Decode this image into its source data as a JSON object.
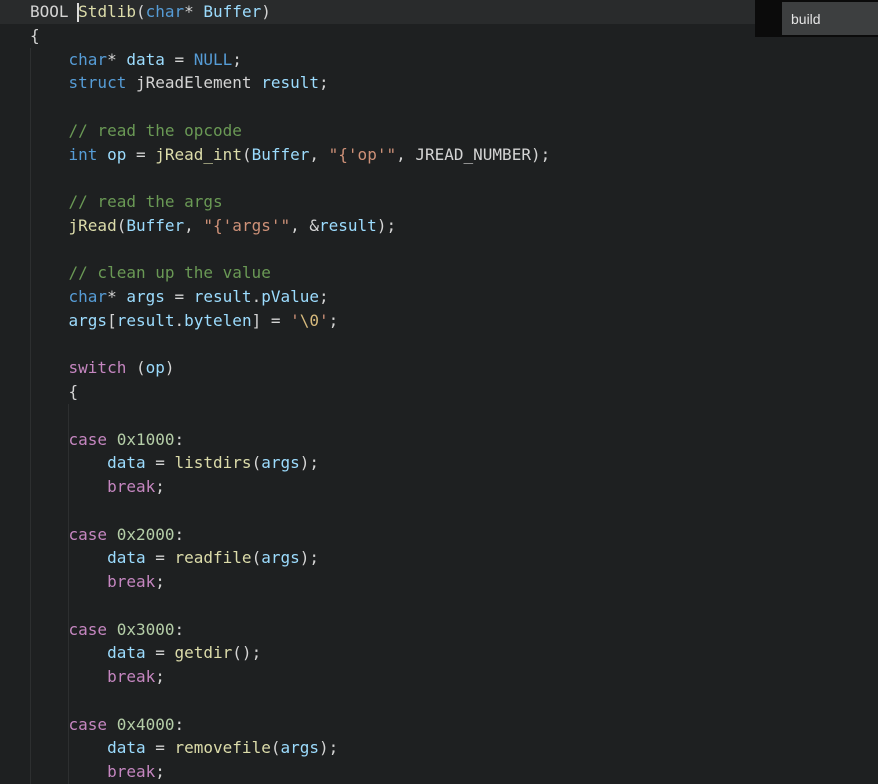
{
  "overlay": {
    "build_label": "build"
  },
  "colors": {
    "background": "#1e2021",
    "current_line": "rgba(255,255,255,0.05)",
    "default": "#d4d4d4",
    "keyword": "#569cd6",
    "control": "#c586c0",
    "function": "#dcdcaa",
    "variable": "#9cdcfe",
    "comment": "#6a9955",
    "string": "#ce9178",
    "number": "#b5cea8",
    "escape": "#d7ba7d"
  },
  "code": {
    "language": "c",
    "current_line": 0,
    "lines": [
      {
        "tokens": [
          {
            "t": "BOOL ",
            "c": "default"
          },
          {
            "t": "Stdlib",
            "c": "function"
          },
          {
            "t": "(",
            "c": "default"
          },
          {
            "t": "char",
            "c": "keyword"
          },
          {
            "t": "* ",
            "c": "default"
          },
          {
            "t": "Buffer",
            "c": "variable"
          },
          {
            "t": ")",
            "c": "default"
          }
        ]
      },
      {
        "tokens": [
          {
            "t": "{",
            "c": "default"
          }
        ]
      },
      {
        "tokens": [
          {
            "t": "    ",
            "c": "default"
          },
          {
            "t": "char",
            "c": "keyword"
          },
          {
            "t": "* ",
            "c": "default"
          },
          {
            "t": "data",
            "c": "variable"
          },
          {
            "t": " = ",
            "c": "default"
          },
          {
            "t": "NULL",
            "c": "keyword"
          },
          {
            "t": ";",
            "c": "default"
          }
        ]
      },
      {
        "tokens": [
          {
            "t": "    ",
            "c": "default"
          },
          {
            "t": "struct",
            "c": "keyword"
          },
          {
            "t": " jReadElement ",
            "c": "default"
          },
          {
            "t": "result",
            "c": "variable"
          },
          {
            "t": ";",
            "c": "default"
          }
        ]
      },
      {
        "tokens": []
      },
      {
        "tokens": [
          {
            "t": "    ",
            "c": "default"
          },
          {
            "t": "// read the opcode",
            "c": "comment"
          }
        ]
      },
      {
        "tokens": [
          {
            "t": "    ",
            "c": "default"
          },
          {
            "t": "int",
            "c": "keyword"
          },
          {
            "t": " ",
            "c": "default"
          },
          {
            "t": "op",
            "c": "variable"
          },
          {
            "t": " = ",
            "c": "default"
          },
          {
            "t": "jRead_int",
            "c": "function"
          },
          {
            "t": "(",
            "c": "default"
          },
          {
            "t": "Buffer",
            "c": "variable"
          },
          {
            "t": ", ",
            "c": "default"
          },
          {
            "t": "\"{'op'\"",
            "c": "string"
          },
          {
            "t": ", ",
            "c": "default"
          },
          {
            "t": "JREAD_NUMBER",
            "c": "default"
          },
          {
            "t": ");",
            "c": "default"
          }
        ]
      },
      {
        "tokens": []
      },
      {
        "tokens": [
          {
            "t": "    ",
            "c": "default"
          },
          {
            "t": "// read the args",
            "c": "comment"
          }
        ]
      },
      {
        "tokens": [
          {
            "t": "    ",
            "c": "default"
          },
          {
            "t": "jRead",
            "c": "function"
          },
          {
            "t": "(",
            "c": "default"
          },
          {
            "t": "Buffer",
            "c": "variable"
          },
          {
            "t": ", ",
            "c": "default"
          },
          {
            "t": "\"{'args'\"",
            "c": "string"
          },
          {
            "t": ", &",
            "c": "default"
          },
          {
            "t": "result",
            "c": "variable"
          },
          {
            "t": ");",
            "c": "default"
          }
        ]
      },
      {
        "tokens": []
      },
      {
        "tokens": [
          {
            "t": "    ",
            "c": "default"
          },
          {
            "t": "// clean up the value",
            "c": "comment"
          }
        ]
      },
      {
        "tokens": [
          {
            "t": "    ",
            "c": "default"
          },
          {
            "t": "char",
            "c": "keyword"
          },
          {
            "t": "* ",
            "c": "default"
          },
          {
            "t": "args",
            "c": "variable"
          },
          {
            "t": " = ",
            "c": "default"
          },
          {
            "t": "result",
            "c": "variable"
          },
          {
            "t": ".",
            "c": "default"
          },
          {
            "t": "pValue",
            "c": "variable"
          },
          {
            "t": ";",
            "c": "default"
          }
        ]
      },
      {
        "tokens": [
          {
            "t": "    ",
            "c": "default"
          },
          {
            "t": "args",
            "c": "variable"
          },
          {
            "t": "[",
            "c": "default"
          },
          {
            "t": "result",
            "c": "variable"
          },
          {
            "t": ".",
            "c": "default"
          },
          {
            "t": "bytelen",
            "c": "variable"
          },
          {
            "t": "] = ",
            "c": "default"
          },
          {
            "t": "'",
            "c": "string"
          },
          {
            "t": "\\0",
            "c": "escape"
          },
          {
            "t": "'",
            "c": "string"
          },
          {
            "t": ";",
            "c": "default"
          }
        ]
      },
      {
        "tokens": []
      },
      {
        "tokens": [
          {
            "t": "    ",
            "c": "default"
          },
          {
            "t": "switch",
            "c": "control"
          },
          {
            "t": " (",
            "c": "default"
          },
          {
            "t": "op",
            "c": "variable"
          },
          {
            "t": ")",
            "c": "default"
          }
        ]
      },
      {
        "tokens": [
          {
            "t": "    {",
            "c": "default"
          }
        ]
      },
      {
        "tokens": []
      },
      {
        "tokens": [
          {
            "t": "    ",
            "c": "default"
          },
          {
            "t": "case",
            "c": "control"
          },
          {
            "t": " ",
            "c": "default"
          },
          {
            "t": "0x1000",
            "c": "number"
          },
          {
            "t": ":",
            "c": "default"
          }
        ]
      },
      {
        "tokens": [
          {
            "t": "        ",
            "c": "default"
          },
          {
            "t": "data",
            "c": "variable"
          },
          {
            "t": " = ",
            "c": "default"
          },
          {
            "t": "listdirs",
            "c": "function"
          },
          {
            "t": "(",
            "c": "default"
          },
          {
            "t": "args",
            "c": "variable"
          },
          {
            "t": ");",
            "c": "default"
          }
        ]
      },
      {
        "tokens": [
          {
            "t": "        ",
            "c": "default"
          },
          {
            "t": "break",
            "c": "control"
          },
          {
            "t": ";",
            "c": "default"
          }
        ]
      },
      {
        "tokens": []
      },
      {
        "tokens": [
          {
            "t": "    ",
            "c": "default"
          },
          {
            "t": "case",
            "c": "control"
          },
          {
            "t": " ",
            "c": "default"
          },
          {
            "t": "0x2000",
            "c": "number"
          },
          {
            "t": ":",
            "c": "default"
          }
        ]
      },
      {
        "tokens": [
          {
            "t": "        ",
            "c": "default"
          },
          {
            "t": "data",
            "c": "variable"
          },
          {
            "t": " = ",
            "c": "default"
          },
          {
            "t": "readfile",
            "c": "function"
          },
          {
            "t": "(",
            "c": "default"
          },
          {
            "t": "args",
            "c": "variable"
          },
          {
            "t": ");",
            "c": "default"
          }
        ]
      },
      {
        "tokens": [
          {
            "t": "        ",
            "c": "default"
          },
          {
            "t": "break",
            "c": "control"
          },
          {
            "t": ";",
            "c": "default"
          }
        ]
      },
      {
        "tokens": []
      },
      {
        "tokens": [
          {
            "t": "    ",
            "c": "default"
          },
          {
            "t": "case",
            "c": "control"
          },
          {
            "t": " ",
            "c": "default"
          },
          {
            "t": "0x3000",
            "c": "number"
          },
          {
            "t": ":",
            "c": "default"
          }
        ]
      },
      {
        "tokens": [
          {
            "t": "        ",
            "c": "default"
          },
          {
            "t": "data",
            "c": "variable"
          },
          {
            "t": " = ",
            "c": "default"
          },
          {
            "t": "getdir",
            "c": "function"
          },
          {
            "t": "();",
            "c": "default"
          }
        ]
      },
      {
        "tokens": [
          {
            "t": "        ",
            "c": "default"
          },
          {
            "t": "break",
            "c": "control"
          },
          {
            "t": ";",
            "c": "default"
          }
        ]
      },
      {
        "tokens": []
      },
      {
        "tokens": [
          {
            "t": "    ",
            "c": "default"
          },
          {
            "t": "case",
            "c": "control"
          },
          {
            "t": " ",
            "c": "default"
          },
          {
            "t": "0x4000",
            "c": "number"
          },
          {
            "t": ":",
            "c": "default"
          }
        ]
      },
      {
        "tokens": [
          {
            "t": "        ",
            "c": "default"
          },
          {
            "t": "data",
            "c": "variable"
          },
          {
            "t": " = ",
            "c": "default"
          },
          {
            "t": "removefile",
            "c": "function"
          },
          {
            "t": "(",
            "c": "default"
          },
          {
            "t": "args",
            "c": "variable"
          },
          {
            "t": ");",
            "c": "default"
          }
        ]
      },
      {
        "tokens": [
          {
            "t": "        ",
            "c": "default"
          },
          {
            "t": "break",
            "c": "control"
          },
          {
            "t": ";",
            "c": "default"
          }
        ]
      }
    ]
  }
}
